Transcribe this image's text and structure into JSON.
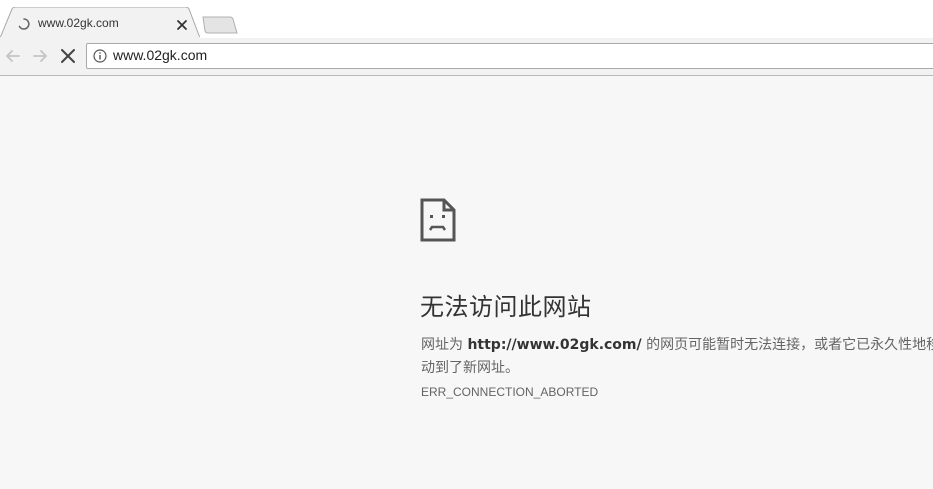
{
  "tab": {
    "title": "www.02gk.com",
    "loading": true
  },
  "toolbar": {
    "back_icon": "back-arrow-icon",
    "forward_icon": "forward-arrow-icon",
    "stop_icon": "stop-icon",
    "url": "www.02gk.com",
    "site_info_icon": "info-icon"
  },
  "error": {
    "icon": "sad-page-icon",
    "heading": "无法访问此网站",
    "desc_prefix": "网址为 ",
    "desc_url": "http://www.02gk.com/",
    "desc_suffix": " 的网页可能暂时无法连接，或者它已永久性地移动到了新网址。",
    "code": "ERR_CONNECTION_ABORTED"
  },
  "colors": {
    "page_bg": "#f7f7f7",
    "toolbar_bg": "#f2f2f2",
    "text_primary": "#333333",
    "text_secondary": "#646464"
  }
}
